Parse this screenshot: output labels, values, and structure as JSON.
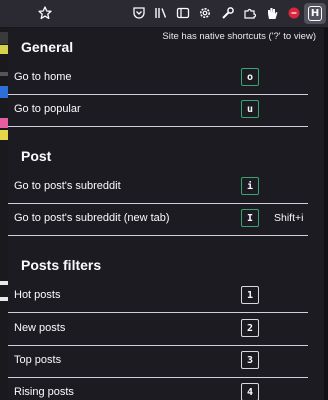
{
  "toolbar": {
    "icons": [
      "star-icon",
      "pocket-icon",
      "library-icon",
      "reader-view-icon",
      "settings-icon",
      "wrench-icon",
      "extensions-icon",
      "hand-icon",
      "red-extension-icon",
      "shortcut-extension-icon"
    ],
    "badge_glyph": "H"
  },
  "panel": {
    "note": "Site has native shortcuts ('?' to view)",
    "sections": [
      {
        "title": "General",
        "rows": [
          {
            "label": "Go to home",
            "key": "o",
            "key_style": "green",
            "alt": ""
          },
          {
            "label": "Go to popular",
            "key": "u",
            "key_style": "green",
            "alt": ""
          }
        ]
      },
      {
        "title": "Post",
        "rows": [
          {
            "label": "Go to post's subreddit",
            "key": "i",
            "key_style": "green",
            "alt": ""
          },
          {
            "label": "Go to post's subreddit (new tab)",
            "key": "I",
            "key_style": "green",
            "alt": "Shift+i"
          }
        ]
      },
      {
        "title": "Posts filters",
        "rows": [
          {
            "label": "Hot posts",
            "key": "1",
            "key_style": "white",
            "alt": ""
          },
          {
            "label": "New posts",
            "key": "2",
            "key_style": "white",
            "alt": ""
          },
          {
            "label": "Top posts",
            "key": "3",
            "key_style": "white",
            "alt": ""
          },
          {
            "label": "Rising posts",
            "key": "4",
            "key_style": "white",
            "alt": ""
          }
        ]
      }
    ]
  },
  "colors": {
    "panel_bg": "#1c1b22",
    "toolbar_bg": "#2b2a33",
    "key_green": "#3aa66e",
    "key_white": "#d8d8de",
    "divider": "#cfcfd8"
  }
}
